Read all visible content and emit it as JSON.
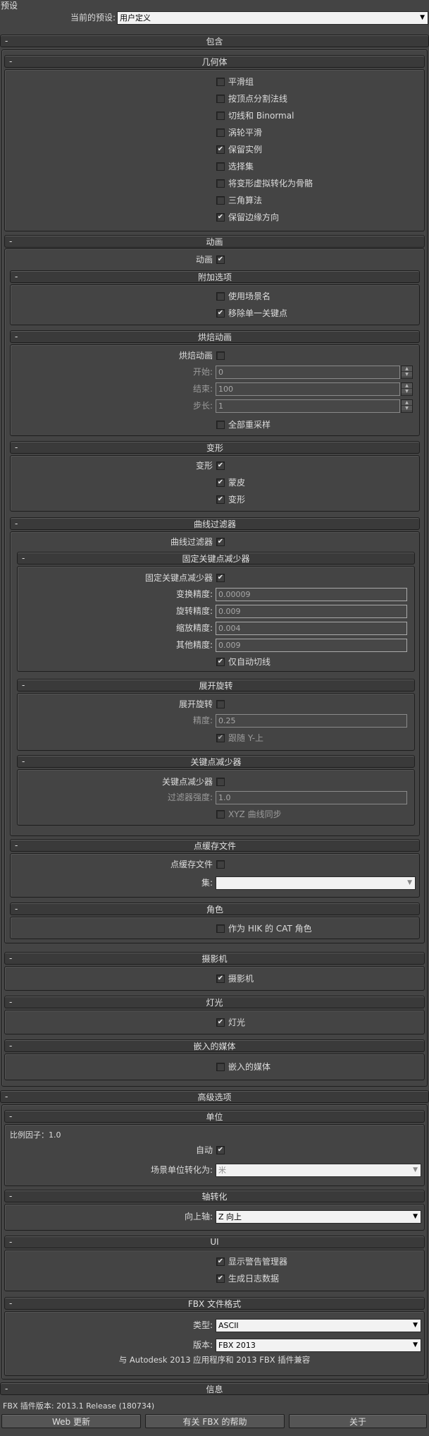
{
  "preset": {
    "title": "预设",
    "current_label": "当前的预设:",
    "current_value": "用户定义"
  },
  "include": {
    "title": "包含",
    "geometry": {
      "title": "几何体",
      "items": [
        {
          "label": "平滑组",
          "checked": false
        },
        {
          "label": "按顶点分割法线",
          "checked": false
        },
        {
          "label": "切线和 Binormal",
          "checked": false
        },
        {
          "label": "涡轮平滑",
          "checked": false
        },
        {
          "label": "保留实例",
          "checked": true
        },
        {
          "label": "选择集",
          "checked": false
        },
        {
          "label": "将变形虚拟转化为骨骼",
          "checked": false
        },
        {
          "label": "三角算法",
          "checked": false
        },
        {
          "label": "保留边缘方向",
          "checked": true
        }
      ]
    },
    "animation": {
      "title": "动画",
      "animation_label": "动画",
      "animation_checked": true,
      "extra": {
        "title": "附加选项",
        "use_scene_name": "使用场景名",
        "use_scene_name_checked": false,
        "remove_single_key": "移除单一关键点",
        "remove_single_key_checked": true
      },
      "bake": {
        "title": "烘焙动画",
        "bake_label": "烘焙动画",
        "bake_checked": false,
        "start_label": "开始:",
        "start_value": "0",
        "end_label": "结束:",
        "end_value": "100",
        "step_label": "步长:",
        "step_value": "1",
        "resample": "全部重采样",
        "resample_checked": false
      },
      "deform": {
        "title": "变形",
        "deform_label": "变形",
        "deform_checked": true,
        "skin": "蒙皮",
        "skin_checked": true,
        "morph": "变形",
        "morph_checked": true
      },
      "curve": {
        "title": "曲线过滤器",
        "curve_label": "曲线过滤器",
        "curve_checked": true,
        "const_key": {
          "title": "固定关键点减少器",
          "label": "固定关键点减少器",
          "checked": true,
          "trans_label": "变换精度:",
          "trans_value": "0.00009",
          "rot_label": "旋转精度:",
          "rot_value": "0.009",
          "scale_label": "缩放精度:",
          "scale_value": "0.004",
          "other_label": "其他精度:",
          "other_value": "0.009",
          "auto_tangent": "仅自动切线",
          "auto_tangent_checked": true
        },
        "unroll": {
          "title": "展开旋转",
          "label": "展开旋转",
          "checked": false,
          "precision_label": "精度:",
          "precision_value": "0.25",
          "follow_y": "跟随 Y-上",
          "follow_y_checked": true
        },
        "key_reducer": {
          "title": "关键点减少器",
          "label": "关键点减少器",
          "checked": false,
          "strength_label": "过滤器强度:",
          "strength_value": "1.0",
          "xyz_sync": "XYZ 曲线同步",
          "xyz_sync_checked": false
        }
      },
      "point_cache": {
        "title": "点缓存文件",
        "label": "点缓存文件",
        "checked": false,
        "set_label": "集:",
        "set_value": ""
      },
      "character": {
        "title": "角色",
        "hik_cat": "作为 HIK 的 CAT 角色",
        "checked": false
      }
    },
    "camera": {
      "title": "摄影机",
      "label": "摄影机",
      "checked": true
    },
    "light": {
      "title": "灯光",
      "label": "灯光",
      "checked": true
    },
    "media": {
      "title": "嵌入的媒体",
      "label": "嵌入的媒体",
      "checked": false
    }
  },
  "advanced": {
    "title": "高级选项",
    "units": {
      "title": "单位",
      "scale_factor": "比例因子：1.0",
      "auto_label": "自动",
      "auto_checked": true,
      "convert_label": "场景单位转化为:",
      "convert_value": "米"
    },
    "axis": {
      "title": "轴转化",
      "up_label": "向上轴:",
      "up_value": "Z 向上"
    },
    "ui": {
      "title": "UI",
      "show_warnings": "显示警告管理器",
      "show_warnings_checked": true,
      "gen_log": "生成日志数据",
      "gen_log_checked": true
    },
    "fbx_format": {
      "title": "FBX 文件格式",
      "type_label": "类型:",
      "type_value": "ASCII",
      "version_label": "版本:",
      "version_value": "FBX 2013",
      "compat_note": "与 Autodesk 2013 应用程序和 2013 FBX 插件兼容"
    }
  },
  "info": {
    "title": "信息",
    "version_text": "FBX 插件版本: 2013.1 Release (180734)",
    "web_update": "Web 更新",
    "help": "有关 FBX 的帮助",
    "about": "关于"
  },
  "common": {
    "minus": "-",
    "check": "✔",
    "arrow": "▼",
    "up": "▲",
    "down": "▼"
  }
}
